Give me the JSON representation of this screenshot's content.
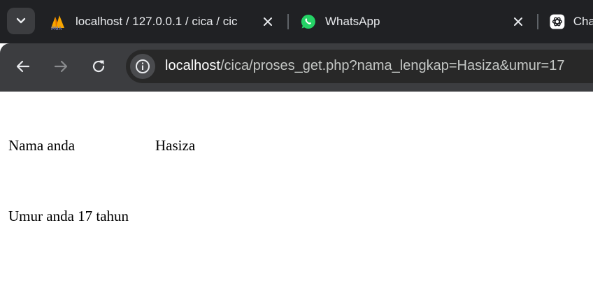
{
  "browser": {
    "tabs": [
      {
        "icon": "phpmyadmin-icon",
        "title": "localhost / 127.0.0.1 / cica / cic"
      },
      {
        "icon": "whatsapp-icon",
        "title": "WhatsApp"
      },
      {
        "icon": "chatgpt-icon",
        "title": "Cha"
      }
    ],
    "url": {
      "host": "localhost",
      "path": "/cica/proses_get.php?nama_lengkap=Hasiza&umur=17"
    }
  },
  "page": {
    "name_label": "Nama anda",
    "name_value": "Hasiza",
    "age_line": "Umur anda 17 tahun"
  },
  "colors": {
    "tabbar_bg": "#202124",
    "toolbar_bg": "#3c3d40",
    "omnibox_bg": "#282828",
    "whatsapp_green": "#25d366"
  }
}
